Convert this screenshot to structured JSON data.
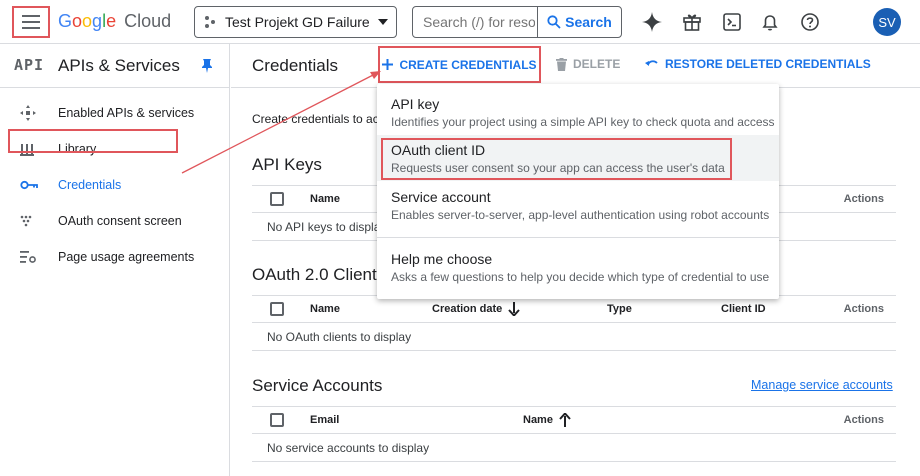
{
  "topbar": {
    "logo_letters": [
      "G",
      "o",
      "o",
      "g",
      "l",
      "e"
    ],
    "logo_suffix": "Cloud",
    "project_name": "Test Projekt GD Failure I",
    "search_placeholder": "Search (/) for reso...",
    "search_button": "Search",
    "avatar_initials": "SV",
    "icons": [
      "menu-icon",
      "project-picker-icon",
      "dropdown-arrow-icon",
      "search-icon",
      "gemini-sparkle-icon",
      "gift-icon",
      "cloud-shell-icon",
      "notifications-bell-icon",
      "help-icon"
    ]
  },
  "sidebar": {
    "api_badge": "API",
    "title": "APIs & Services",
    "items": [
      {
        "label": "Enabled APIs & services",
        "icon": "enabled-apis-icon"
      },
      {
        "label": "Library",
        "icon": "library-icon"
      },
      {
        "label": "Credentials",
        "icon": "key-icon",
        "active": true
      },
      {
        "label": "OAuth consent screen",
        "icon": "oauth-consent-icon"
      },
      {
        "label": "Page usage agreements",
        "icon": "settings-list-icon"
      }
    ]
  },
  "header": {
    "title": "Credentials",
    "create_label": "CREATE CREDENTIALS",
    "delete_label": "DELETE",
    "restore_label": "RESTORE DELETED CREDENTIALS"
  },
  "main": {
    "intro_text": "Create credentials to access your enabled APIs",
    "api_keys": {
      "title": "API Keys",
      "columns": {
        "name": "Name",
        "actions": "Actions"
      },
      "empty": "No API keys to display"
    },
    "oauth": {
      "title": "OAuth 2.0 Client IDs",
      "columns": {
        "name": "Name",
        "created": "Creation date",
        "type": "Type",
        "client_id": "Client ID",
        "actions": "Actions"
      },
      "empty": "No OAuth clients to display"
    },
    "service_accounts": {
      "title": "Service Accounts",
      "manage_link": "Manage service accounts",
      "columns": {
        "email": "Email",
        "name": "Name",
        "actions": "Actions"
      },
      "empty": "No service accounts to display"
    }
  },
  "dropdown": {
    "items": [
      {
        "title": "API key",
        "desc": "Identifies your project using a simple API key to check quota and access"
      },
      {
        "title": "OAuth client ID",
        "desc": "Requests user consent so your app can access the user's data",
        "highlighted": true
      },
      {
        "title": "Service account",
        "desc": "Enables server-to-server, app-level authentication using robot accounts"
      },
      {
        "title": "Help me choose",
        "desc": "Asks a few questions to help you decide which type of credential to use"
      }
    ]
  },
  "colors": {
    "accent": "#1a73e8",
    "annotation": "#e0565b",
    "avatar": "#1a5fb4"
  }
}
